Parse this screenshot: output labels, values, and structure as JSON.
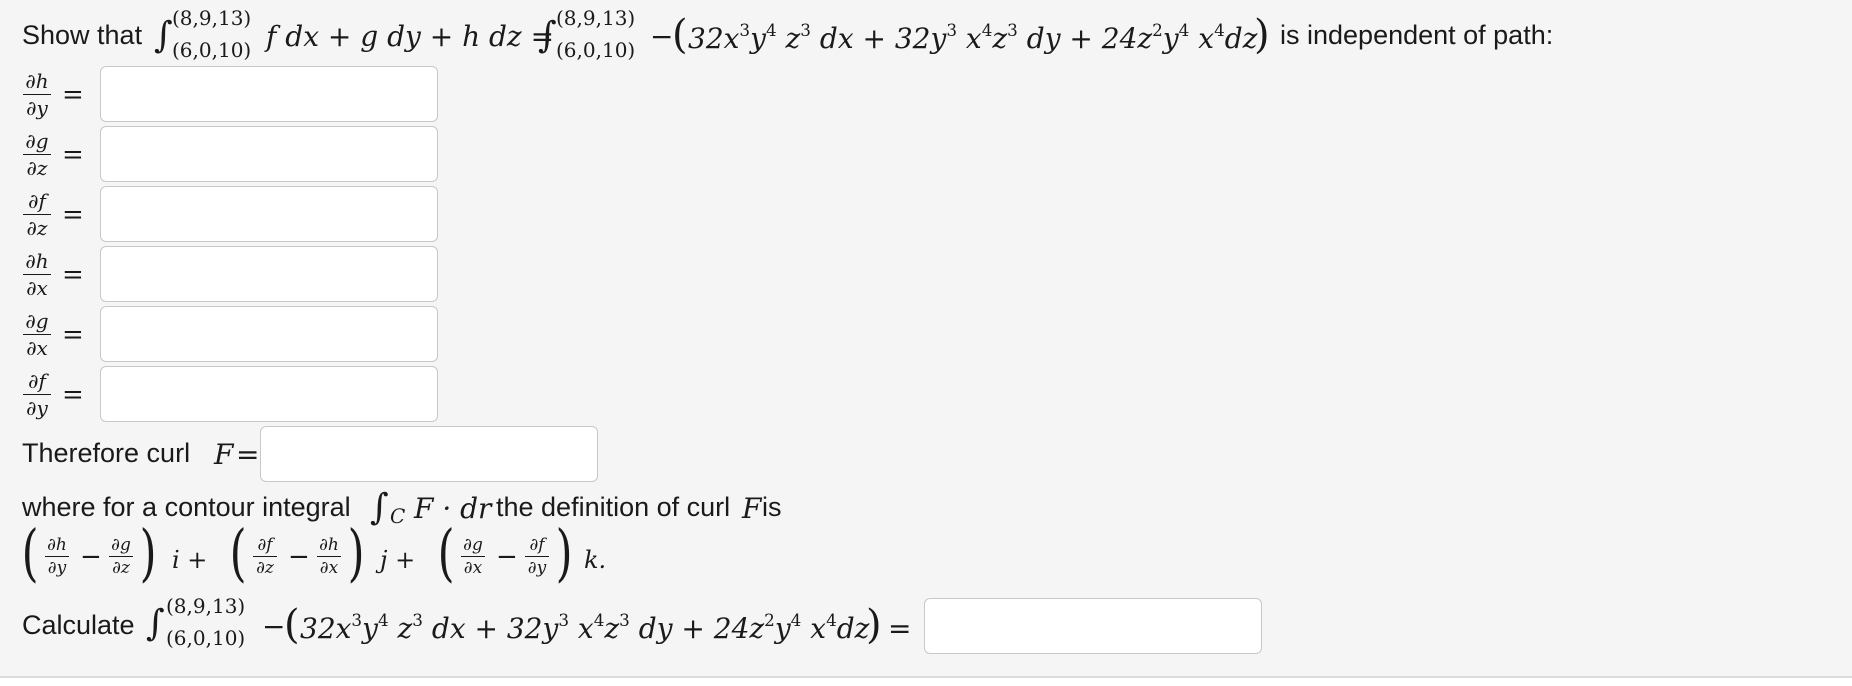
{
  "header": {
    "show_that": "Show that",
    "lower_limit": "(6,0,10)",
    "upper_limit": "(8,9,13)",
    "lhs_integrand": "f dx + g dy + h dz =",
    "rhs_minus": "−",
    "rhs_terms": [
      "32x",
      "y",
      "z",
      "dx + 32y",
      "x",
      "z",
      "dy + 24z",
      "y",
      "x",
      "dz"
    ],
    "rhs_exps": [
      "3",
      "4",
      "3",
      "3",
      "4",
      "3",
      "2",
      "4",
      "4"
    ],
    "independent": "is independent of path:"
  },
  "partials": [
    {
      "num": "∂h",
      "den": "∂y",
      "eq": "=",
      "value": ""
    },
    {
      "num": "∂g",
      "den": "∂z",
      "eq": "=",
      "value": ""
    },
    {
      "num": "∂f",
      "den": "∂z",
      "eq": "=",
      "value": ""
    },
    {
      "num": "∂h",
      "den": "∂x",
      "eq": "=",
      "value": ""
    },
    {
      "num": "∂g",
      "den": "∂x",
      "eq": "=",
      "value": ""
    },
    {
      "num": "∂f",
      "den": "∂y",
      "eq": "=",
      "value": ""
    }
  ],
  "curl": {
    "label": "Therefore curl",
    "F": "F",
    "eq": "=",
    "value": ""
  },
  "definition": {
    "text_before": "where for a contour integral",
    "contour_sub": "C",
    "integrand": "F · dr",
    "text_after": "the definition of curl",
    "F": "F",
    "is": "is",
    "terms": [
      {
        "a_num": "∂h",
        "a_den": "∂y",
        "b_num": "∂g",
        "b_den": "∂z",
        "unit": "i +"
      },
      {
        "a_num": "∂f",
        "a_den": "∂z",
        "b_num": "∂h",
        "b_den": "∂x",
        "unit": "j +"
      },
      {
        "a_num": "∂g",
        "a_den": "∂x",
        "b_num": "∂f",
        "b_den": "∂y",
        "unit": "k."
      }
    ],
    "minus": "−"
  },
  "calculate": {
    "label": "Calculate",
    "eq": "=",
    "value": ""
  }
}
